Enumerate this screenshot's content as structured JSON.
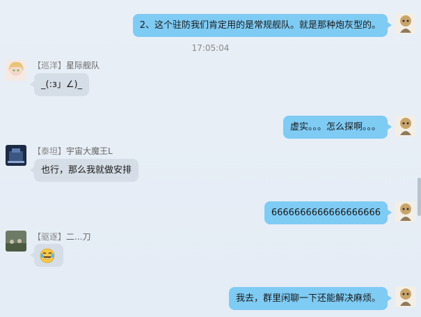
{
  "messages": [
    {
      "type": "out",
      "text": "2、这个驻防我们肯定用的是常规舰队。就是那种炮灰型的。"
    },
    {
      "type": "time",
      "text": "17:05:04"
    },
    {
      "type": "in",
      "tag": "【巡洋】",
      "name": "星际舰队",
      "text": "_(:з」∠)_"
    },
    {
      "type": "out",
      "text": "虚实。。。怎么探啊。。。"
    },
    {
      "type": "in",
      "tag": "【泰坦】",
      "name": "宇宙大魔王L",
      "text": "也行，那么我就做安排"
    },
    {
      "type": "out",
      "text": "6666666666666666666"
    },
    {
      "type": "in",
      "tag": "【驱逐】",
      "name": "二...刀",
      "emoji": "laughing-tears-emoji"
    },
    {
      "type": "out",
      "text": "我去，群里闲聊一下还能解决麻烦。"
    }
  ],
  "colors": {
    "outgoing_bubble": "#7ecbf4",
    "incoming_bubble": "#d5dde6",
    "background": "#e6edf5"
  }
}
